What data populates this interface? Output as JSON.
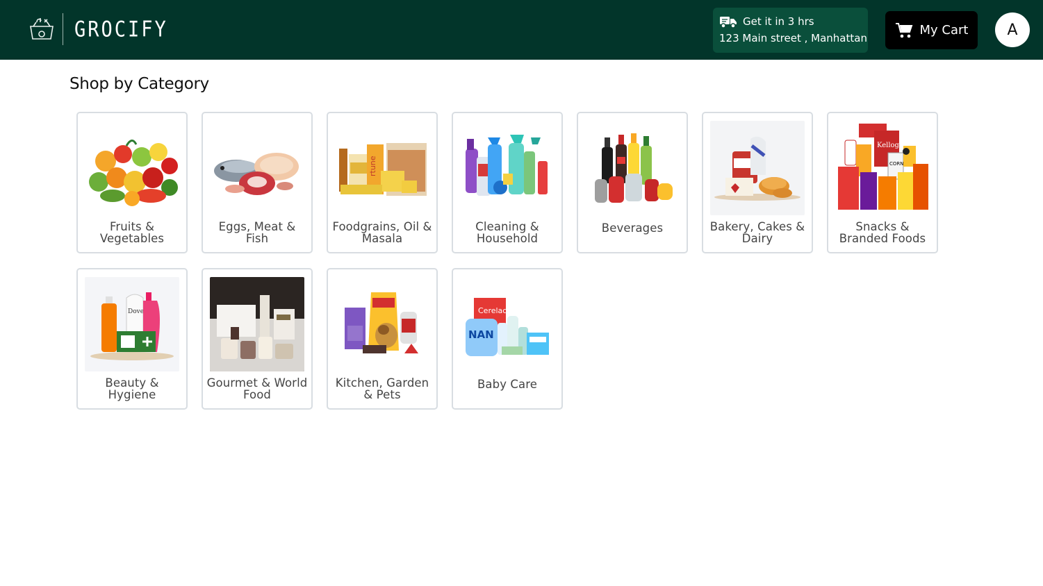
{
  "header": {
    "brand": "GROCIFY",
    "logo_icon": "basket-icon",
    "delivery": {
      "icon": "truck-icon",
      "eta": "Get it in 3 hrs",
      "address": "123 Main street , Manhattan"
    },
    "cart": {
      "icon": "cart-icon",
      "label": "My Cart"
    },
    "avatar_initial": "A"
  },
  "colors": {
    "header_bg": "#02352a",
    "delivery_bg": "#0a4f3b",
    "cart_bg": "#000000",
    "card_border": "#d8dde2"
  },
  "main": {
    "title": "Shop by Category",
    "categories": [
      {
        "label": "Fruits & Vegetables",
        "thumb": "fruits-vegetables"
      },
      {
        "label": "Eggs, Meat & Fish",
        "thumb": "eggs-meat-fish"
      },
      {
        "label": "Foodgrains, Oil & Masala",
        "thumb": "foodgrains"
      },
      {
        "label": "Cleaning & Household",
        "thumb": "cleaning"
      },
      {
        "label": "Beverages",
        "thumb": "beverages"
      },
      {
        "label": "Bakery, Cakes & Dairy",
        "thumb": "bakery"
      },
      {
        "label": "Snacks & Branded Foods",
        "thumb": "snacks"
      },
      {
        "label": "Beauty & Hygiene",
        "thumb": "beauty"
      },
      {
        "label": "Gourmet & World Food",
        "thumb": "gourmet"
      },
      {
        "label": "Kitchen, Garden & Pets",
        "thumb": "pets"
      },
      {
        "label": "Baby Care",
        "thumb": "baby-care"
      }
    ]
  }
}
